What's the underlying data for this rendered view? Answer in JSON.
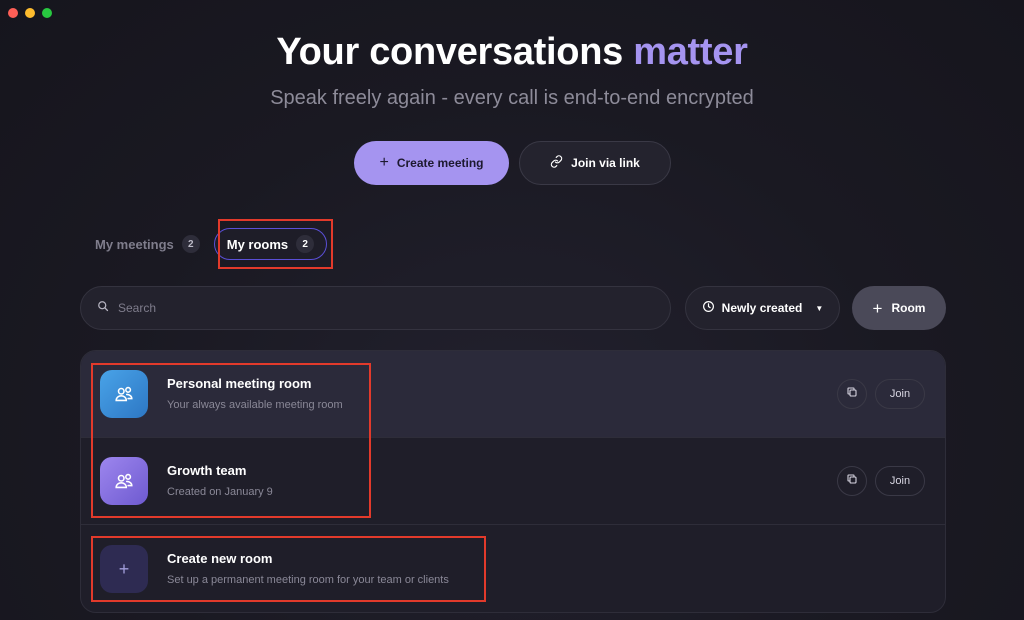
{
  "hero": {
    "title_main": "Your conversations",
    "title_accent": "matter",
    "subtitle": "Speak freely again - every call is end-to-end encrypted"
  },
  "actions": {
    "create_meeting": "Create meeting",
    "join_via_link": "Join via link"
  },
  "tabs": [
    {
      "label": "My meetings",
      "count": "2",
      "active": false
    },
    {
      "label": "My rooms",
      "count": "2",
      "active": true
    }
  ],
  "search": {
    "placeholder": "Search",
    "value": ""
  },
  "sort": {
    "selected": "Newly created"
  },
  "add_room": {
    "label": "Room"
  },
  "rooms": [
    {
      "name": "Personal meeting room",
      "desc": "Your always available meeting room",
      "join": "Join",
      "icon": "people-icon"
    },
    {
      "name": "Growth team",
      "desc": "Created on January 9",
      "join": "Join",
      "icon": "people-icon"
    }
  ],
  "create_room": {
    "name": "Create new room",
    "desc": "Set up a permanent meeting room for your team or clients"
  },
  "colors": {
    "accent": "#a594f0",
    "background": "#1a1922",
    "annotation": "#e23a2b"
  }
}
